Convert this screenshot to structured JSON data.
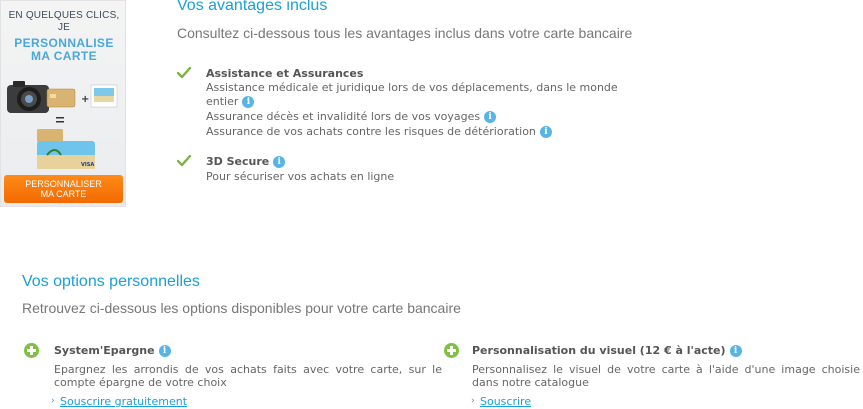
{
  "promo": {
    "head_line1": "EN QUELQUES CLICS,",
    "head_line2": "JE",
    "title_line1": "PERSONNALISE",
    "title_line2": "MA CARTE",
    "button_line1": "PERSONNALISER",
    "button_line2": "MA CARTE"
  },
  "advantages": {
    "title": "Vos avantages inclus",
    "subtitle": "Consultez ci-dessous tous les avantages inclus dans votre carte bancaire",
    "items": [
      {
        "title": "Assistance et Assurances",
        "lines": [
          "Assistance médicale et juridique lors de vos déplacements, dans le monde",
          "entier",
          "Assurance décès et invalidité lors de vos voyages",
          "Assurance de vos achats contre les risques de détérioration"
        ]
      },
      {
        "title": "3D Secure",
        "lines": [
          "Pour sécuriser vos achats en ligne"
        ]
      }
    ]
  },
  "options": {
    "title": "Vos options personnelles",
    "subtitle": "Retrouvez ci-dessous les options disponibles pour votre carte bancaire",
    "items": [
      {
        "title": "System'Epargne",
        "desc": "Epargnez les arrondis de vos achats faits avec votre carte, sur le compte épargne de votre choix",
        "link": "Souscrire gratuitement"
      },
      {
        "title": "Personnalisation du visuel (12 € à l'acte)",
        "desc": "Personnalisez le visuel de votre carte à l'aide d'une image choisie dans notre catalogue",
        "link": "Souscrire"
      }
    ]
  },
  "icons": {
    "info": "i",
    "chevron": "›"
  },
  "colors": {
    "accent": "#1aa1d6",
    "orange": "#f26a00",
    "green": "#7fc241",
    "check": "#7ab342"
  }
}
